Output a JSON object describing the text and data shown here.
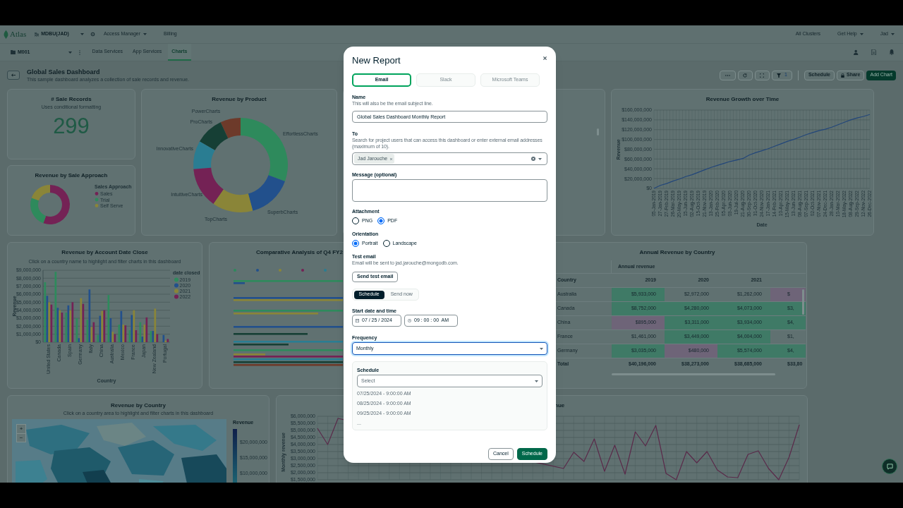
{
  "top_nav": {
    "logo": "Atlas",
    "organization": "MDBU(JAD)",
    "items": [
      {
        "label": "Access Manager",
        "dropdown": true
      },
      {
        "label": "Billing",
        "dropdown": false
      }
    ],
    "right_items": [
      {
        "label": "All Clusters",
        "dropdown": false
      },
      {
        "label": "Get Help",
        "dropdown": true
      },
      {
        "label": "Jad",
        "dropdown": true
      }
    ]
  },
  "project_nav": {
    "project": "M001",
    "tabs": [
      {
        "label": "Data Services",
        "selected": false
      },
      {
        "label": "App Services",
        "selected": false
      },
      {
        "label": "Charts",
        "selected": true
      }
    ]
  },
  "dashboard": {
    "title": "Global Sales Dashboard",
    "description": "This sample dashboard analyzes a collection of sale records and revenue.",
    "filter_count": "1",
    "buttons": [
      {
        "label": "Schedule",
        "kind": "plain"
      },
      {
        "label": "Share",
        "kind": "lock"
      },
      {
        "label": "Add Chart",
        "kind": "primary"
      }
    ]
  },
  "charts": {
    "sale_records": {
      "title": "# Sale Records",
      "subtitle": "Uses conditional formatting",
      "value": "299"
    },
    "sale_approach": {
      "title": "Revenue by Sale Approach",
      "legend_title": "Sales Approach",
      "items": [
        {
          "label": "Sales",
          "color": "#742255"
        },
        {
          "label": "Trial",
          "color": "#2e8a5c"
        },
        {
          "label": "Self Serve",
          "color": "#8a8538"
        }
      ]
    },
    "product": {
      "title": "Revenue by Product",
      "slices": [
        {
          "label": "PowerCharts",
          "color": "#6d3a2a"
        },
        {
          "label": "ProCharts",
          "color": "#163f35"
        },
        {
          "label": "EffortlessCharts",
          "color": "#2e8a5c"
        },
        {
          "label": "InnovativeCharts",
          "color": "#2a7d92"
        },
        {
          "label": "IntuitiveCharts",
          "color": "#742255"
        },
        {
          "label": "SuperbCharts",
          "color": "#22508c"
        },
        {
          "label": "TopCharts",
          "color": "#8a8538"
        }
      ]
    },
    "growth": {
      "title": "Revenue Growth over Time",
      "chart_data": {
        "type": "line",
        "xlabel": "Date",
        "ylabel": "Revenue",
        "grid": true,
        "x": [
          "05-Jan-2019",
          "27-Jan-2019",
          "27-Feb-2019",
          "26-Mar-2019",
          "20-May-2019",
          "15-Jun-2019",
          "02-Aug-2019",
          "15-Oct-2019",
          "21-Nov-2019",
          "13-Jan-2020",
          "25-Feb-2020",
          "05-Apr-2020",
          "03-Jun-2020",
          "19-Jul-2020",
          "21-Aug-2020",
          "30-Sep-2020",
          "31-Oct-2020",
          "24-Nov-2020",
          "17-Jan-2021",
          "14-Feb-2021",
          "10-Apr-2021",
          "15-May-2021",
          "13-Jun-2021",
          "08-Aug-2021",
          "07-Sep-2021",
          "02-Oct-2021",
          "07-Nov-2021",
          "24-Dec-2021",
          "28-Jan-2022",
          "10-Mar-2022",
          "18-May-2022",
          "08-Aug-2022",
          "29-Sep-2022",
          "12-Nov-2022",
          "26-Dec-2022"
        ],
        "series": [
          {
            "color": "#22467a",
            "values": [
              0,
              6000000,
              10000000,
              15000000,
              19000000,
              24000000,
              28000000,
              33000000,
              38000000,
              43000000,
              47000000,
              51000000,
              55000000,
              58000000,
              61000000,
              68000000,
              73000000,
              77000000,
              81000000,
              86000000,
              91000000,
              96000000,
              100000000,
              105000000,
              110000000,
              114000000,
              118000000,
              121000000,
              125000000,
              130000000,
              135000000,
              140000000,
              144000000,
              147000000,
              151000000
            ]
          }
        ],
        "ylim": [
          0,
          160000000
        ],
        "yticks": [
          {
            "value": 0,
            "label": "$0"
          },
          {
            "value": 20000000,
            "label": "$20,000,000"
          },
          {
            "value": 40000000,
            "label": "$40,000,000"
          },
          {
            "value": 60000000,
            "label": "$60,000,000"
          },
          {
            "value": 80000000,
            "label": "$80,000,000"
          },
          {
            "value": 100000000,
            "label": "$100,000,000"
          },
          {
            "value": 120000000,
            "label": "$120,000,000"
          },
          {
            "value": 140000000,
            "label": "$140,000,000"
          },
          {
            "value": 160000000,
            "label": "$160,000,000"
          }
        ]
      }
    },
    "account": {
      "title": "Revenue by Account Date Close",
      "subtitle": "Click on a country name to highlight and filter charts in this dashboard",
      "chart_data": {
        "type": "bar",
        "xlabel": "Country",
        "ylabel": "Revenue",
        "grid": true,
        "legend": {
          "title": "date closed"
        },
        "categories": [
          "United States",
          "Canada",
          "Spain",
          "Germany",
          "Italy",
          "China",
          "Australia",
          "Mexico",
          "France",
          "Japan",
          "New Zealand",
          "Portugal"
        ],
        "series": [
          {
            "name": "2019",
            "color": "#2e8a5c",
            "values": [
              7500000,
              8800000,
              3700000,
              3000000,
              2800000,
              900000,
              5900000,
              2200000,
              1500000,
              2500000,
              1400000,
              null
            ]
          },
          {
            "name": "2020",
            "color": "#22508c",
            "values": [
              5800000,
              4300000,
              4600000,
              500000,
              6600000,
              3300000,
              3000000,
              3900000,
              3400000,
              700000,
              1400000,
              900000
            ]
          },
          {
            "name": "2021",
            "color": "#8a8538",
            "values": [
              5000000,
              4000000,
              4000000,
              5500000,
              1900000,
              3900000,
              1300000,
              2200000,
              4000000,
              2200000,
              4200000,
              200000
            ]
          },
          {
            "name": "2022",
            "color": "#742255",
            "values": [
              4700000,
              3700000,
              5000000,
              4800000,
              2500000,
              4000000,
              1000000,
              2100000,
              1500000,
              3100000,
              1000000,
              400000
            ]
          }
        ],
        "ylim": [
          0,
          9000000
        ],
        "yticks": [
          {
            "value": 0,
            "label": "$0"
          },
          {
            "value": 1000000,
            "label": "$1,000,000"
          },
          {
            "value": 2000000,
            "label": "$2,000,000"
          },
          {
            "value": 3000000,
            "label": "$3,000,000"
          },
          {
            "value": 4000000,
            "label": "$4,000,000"
          },
          {
            "value": 5000000,
            "label": "$5,000,000"
          },
          {
            "value": 6000000,
            "label": "$6,000,000"
          },
          {
            "value": 7000000,
            "label": "$7,000,000"
          },
          {
            "value": 8000000,
            "label": "$8,000,000"
          },
          {
            "value": 9000000,
            "label": "$9,000,000"
          }
        ]
      }
    },
    "comparative": {
      "title": "Comparative Analysis of Q4 FY2"
    },
    "annual": {
      "title": "Annual Revenue by Country",
      "group_header": "Annual revenue",
      "columns": [
        "Country",
        "2019",
        "2020",
        "2021"
      ],
      "rows": [
        {
          "cells": [
            {
              "text": "Australia"
            },
            {
              "text": "$5,933,000",
              "color": "#3f7a66"
            },
            {
              "text": "$2,972,000"
            },
            {
              "text": "$1,262,000"
            },
            {
              "text": "$",
              "color": "#6e6478"
            }
          ]
        },
        {
          "cells": [
            {
              "text": "Canada"
            },
            {
              "text": "$8,752,000",
              "color": "#3f7a66"
            },
            {
              "text": "$4,280,000",
              "color": "#3f7a66"
            },
            {
              "text": "$4,073,000",
              "color": "#3f7a66"
            },
            {
              "text": "$3,",
              "color": "#3f7a66"
            }
          ]
        },
        {
          "cells": [
            {
              "text": "China"
            },
            {
              "text": "$895,000",
              "color": "#6e6478"
            },
            {
              "text": "$3,311,000",
              "color": "#3f7a66"
            },
            {
              "text": "$3,934,000",
              "color": "#3f7a66"
            },
            {
              "text": "$4,",
              "color": "#3f7a66"
            }
          ]
        },
        {
          "cells": [
            {
              "text": "France"
            },
            {
              "text": "$1,461,000"
            },
            {
              "text": "$3,449,000",
              "color": "#3f7a66"
            },
            {
              "text": "$4,004,000",
              "color": "#3f7a66"
            },
            {
              "text": "$1,"
            }
          ]
        },
        {
          "cells": [
            {
              "text": "Germany"
            },
            {
              "text": "$3,035,000",
              "color": "#3f7a66"
            },
            {
              "text": "$480,000",
              "color": "#6e6478"
            },
            {
              "text": "$5,574,000",
              "color": "#3f7a66"
            },
            {
              "text": "$4,",
              "color": "#3f7a66"
            }
          ]
        }
      ],
      "total": [
        "Total",
        "$40,196,000",
        "$38,273,000",
        "$38,685,000",
        "$33,80"
      ]
    },
    "country_map": {
      "title": "Revenue by Country",
      "subtitle": "Click on a country area to highlight and filter charts in this dashboard",
      "zoom_controls": [
        "+",
        "−"
      ],
      "legend_title": "Revenue",
      "legend_labels": [
        "$20,000,000",
        "$15,000,000",
        "$10,000,000"
      ]
    },
    "monthly": {
      "title": "nue",
      "chart_data": {
        "type": "line",
        "ylabel": "Monthly revenue",
        "grid": true,
        "ylim": [
          1500000,
          6000000
        ],
        "yticks": [
          {
            "value": 6000000,
            "label": "$6,000,000"
          },
          {
            "value": 5500000,
            "label": "$5,500,000"
          },
          {
            "value": 5000000,
            "label": "$5,000,000"
          },
          {
            "value": 4500000,
            "label": "$4,500,000"
          },
          {
            "value": 4000000,
            "label": "$4,000,000"
          },
          {
            "value": 3500000,
            "label": "$3,500,000"
          },
          {
            "value": 3000000,
            "label": "$3,000,000"
          },
          {
            "value": 2500000,
            "label": "$2,500,000"
          },
          {
            "value": 2000000,
            "label": "$2,000,000"
          },
          {
            "value": 1500000,
            "label": "$1,500,000"
          }
        ],
        "series": [
          {
            "color": "#5a2a4a",
            "values": [
              5150000,
              4000000,
              5850000,
              null,
              null,
              null,
              null,
              null,
              null,
              null,
              null,
              null,
              null,
              null,
              null,
              null,
              null,
              null,
              null,
              null,
              null,
              null,
              null,
              null,
              2300000,
              3450000,
              2800000,
              4400000,
              2100000,
              3950000,
              1900000,
              4900000,
              3900000,
              5350000,
              1950000,
              1500000,
              3500000,
              2700000,
              3500000,
              2200000,
              1700000,
              1650000,
              3300000,
              3550000,
              2300000,
              1500000,
              3100000,
              5400000
            ]
          }
        ]
      }
    }
  },
  "modal": {
    "title": "New Report",
    "tabs": [
      {
        "label": "Email",
        "selected": true,
        "disabled": false
      },
      {
        "label": "Slack",
        "selected": false,
        "disabled": true
      },
      {
        "label": "Microsoft Teams",
        "selected": false,
        "disabled": true
      }
    ],
    "name": {
      "label": "Name",
      "help": "This will also be the email subject line.",
      "value": "Global Sales Dashboard Monthly Report"
    },
    "to": {
      "label": "To",
      "help": "Search for project users that can access this dashboard or enter external email addresses (maximum of 10).",
      "chips": [
        "Jad Jarouche"
      ]
    },
    "message": {
      "label": "Message (optional)"
    },
    "attachment": {
      "label": "Attachment",
      "options": [
        {
          "label": "PNG",
          "selected": false
        },
        {
          "label": "PDF",
          "selected": true
        }
      ]
    },
    "orientation": {
      "label": "Orientation",
      "options": [
        {
          "label": "Portrait",
          "selected": true
        },
        {
          "label": "Landscape",
          "selected": false
        }
      ]
    },
    "test_email": {
      "label": "Test email",
      "help": "Email will be sent to jad.jarouche@mongodb.com.",
      "button": "Send test email"
    },
    "mode": [
      {
        "label": "Schedule",
        "selected": true
      },
      {
        "label": "Send now",
        "selected": false
      }
    ],
    "start": {
      "label": "Start date and time",
      "date": "07 / 25 / 2024",
      "time": "09 : 00 : 00  AM"
    },
    "frequency": {
      "label": "Frequency",
      "value": "Monthly",
      "focused": true
    },
    "schedule": {
      "label": "Schedule",
      "placeholder": "Select",
      "occurrences": [
        "07/25/2024 - 9:00:00 AM",
        "08/25/2024 - 9:00:00 AM",
        "09/25/2024 - 9:00:00 AM",
        "..."
      ]
    },
    "footer_buttons": [
      {
        "label": "Cancel",
        "kind": "secondary"
      },
      {
        "label": "Schedule",
        "kind": "primary"
      }
    ]
  }
}
